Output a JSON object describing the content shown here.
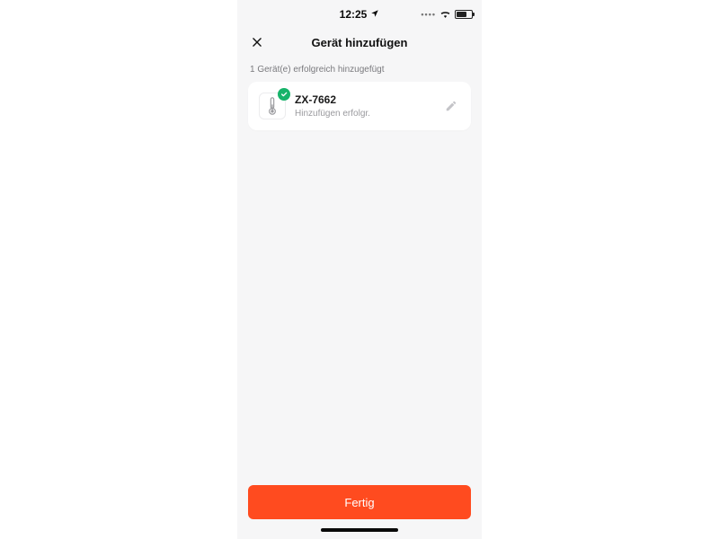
{
  "statusbar": {
    "time": "12:25"
  },
  "nav": {
    "title": "Gerät hinzufügen"
  },
  "summary_text": "1 Gerät(e) erfolgreich hinzugefügt",
  "device": {
    "name": "ZX-7662",
    "status": "Hinzufügen erfolgr."
  },
  "actions": {
    "done_label": "Fertig"
  }
}
